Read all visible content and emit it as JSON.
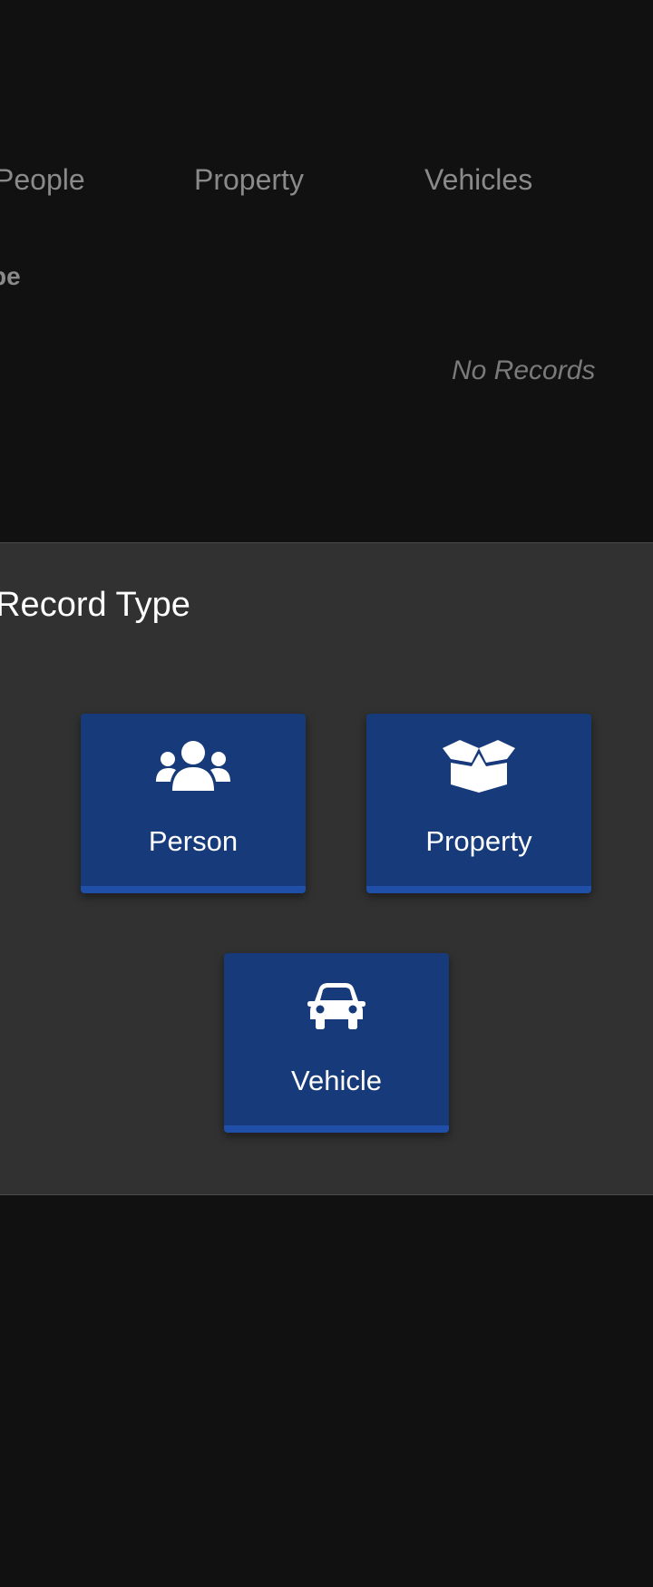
{
  "background": {
    "tabs": [
      {
        "label": "People"
      },
      {
        "label": "Property"
      },
      {
        "label": "Vehicles"
      }
    ],
    "column_header": "pe",
    "empty_text": "No Records"
  },
  "modal": {
    "title": "t Record Type",
    "options": [
      {
        "label": "Person",
        "icon": "people-group-icon"
      },
      {
        "label": "Property",
        "icon": "open-box-icon"
      },
      {
        "label": "Vehicle",
        "icon": "car-icon"
      }
    ]
  },
  "colors": {
    "page_background": "#111111",
    "modal_background": "#313131",
    "button_background": "#163a7a",
    "button_accent": "#1f4fa8",
    "muted_text": "#8a8a8a"
  }
}
